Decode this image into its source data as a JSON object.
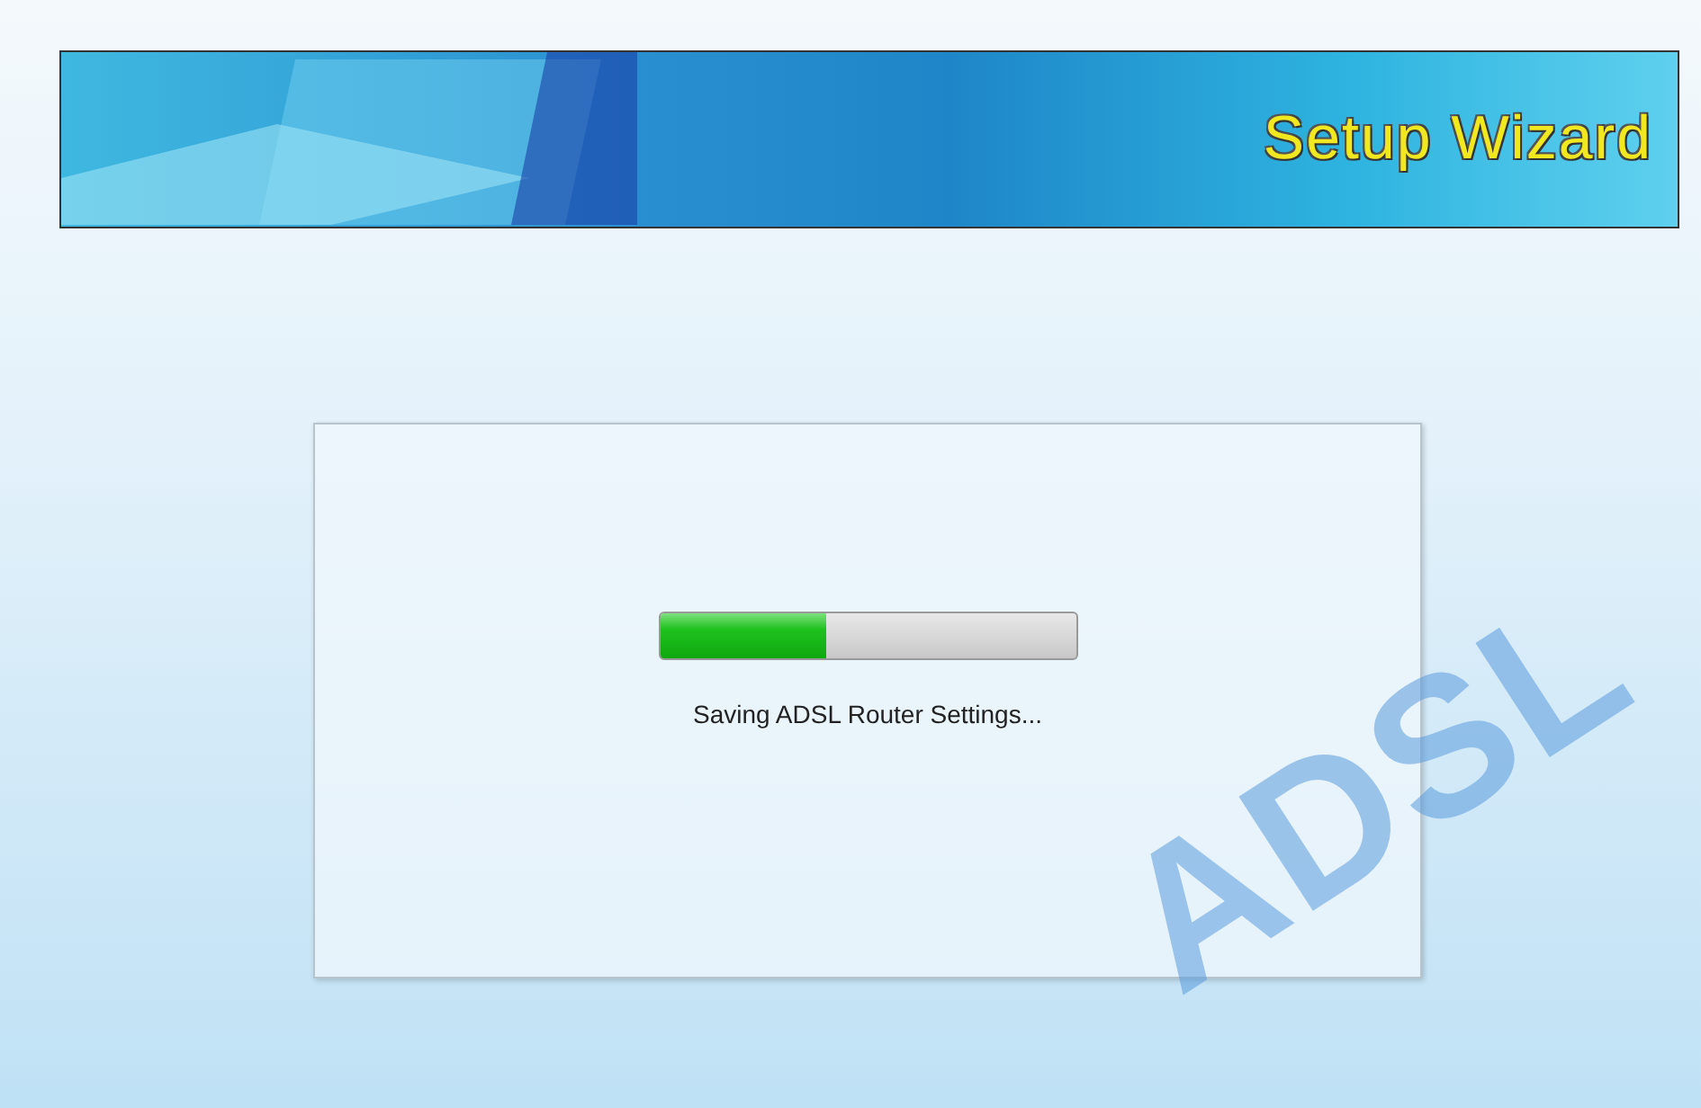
{
  "banner": {
    "title": "Setup Wizard"
  },
  "background_text": "ADSL",
  "progress": {
    "level": 0.4,
    "message": "Saving ADSL Router Settings..."
  }
}
